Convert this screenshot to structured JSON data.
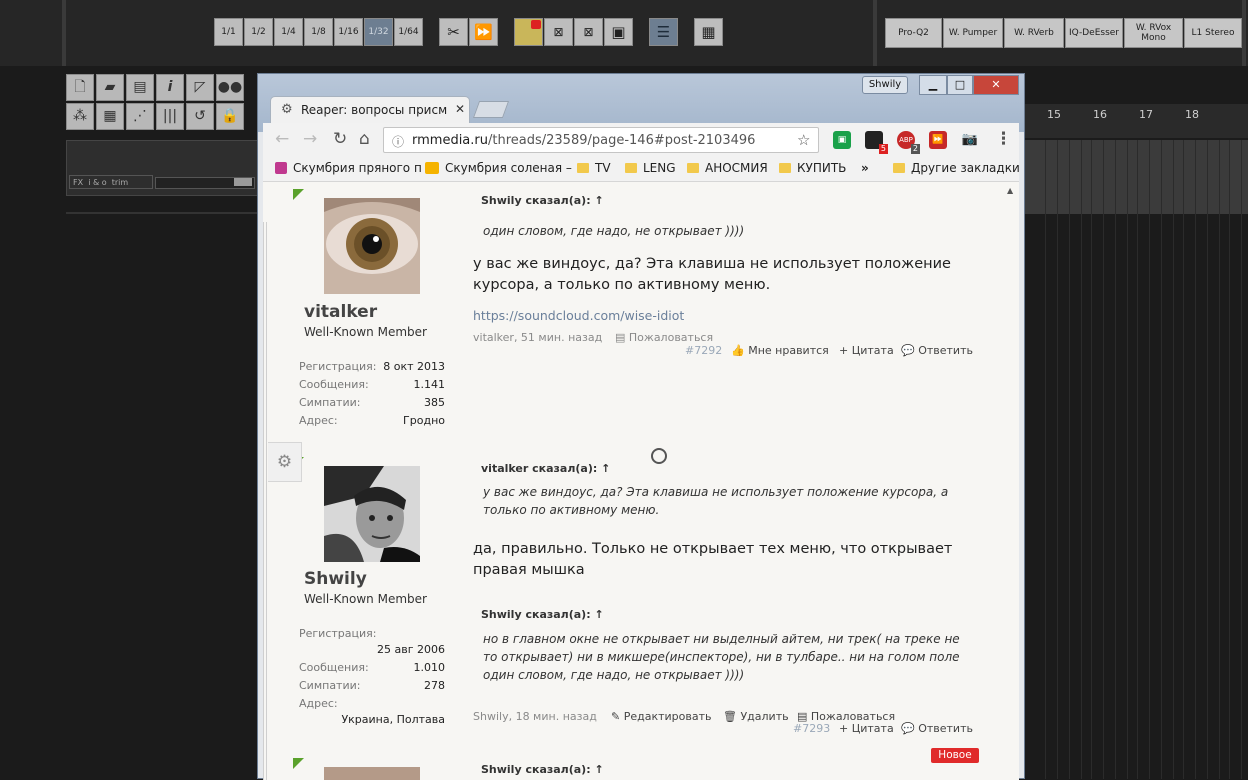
{
  "reaper": {
    "grid_buttons": [
      "1/1",
      "1/2",
      "1/4",
      "1/8",
      "1/16",
      "1/32",
      "1/64"
    ],
    "selected_grid": "1/32",
    "fx_buttons": [
      "Pro-Q2",
      "W. Pumper",
      "W. RVerb",
      "IQ-DeEsser",
      "W. RVox Mono",
      "L1 Stereo"
    ],
    "track_controls": {
      "fx": "FX",
      "io": "i & o",
      "trim": "trim"
    },
    "ruler_numbers": [
      "15",
      "16",
      "17",
      "18"
    ]
  },
  "browser": {
    "profile": "Shwily",
    "window_controls": {
      "minimize": "▁",
      "maximize": "□",
      "close": "✕"
    },
    "tab_title": "Reaper: вопросы присм",
    "url_host": "rmmedia.ru",
    "url_path": "/threads/23589/page-146#post-2103496",
    "bookmarks": [
      "Скумбрия пряного п",
      "Скумбрия соленая –",
      "TV",
      "LENG",
      "АНОСМИЯ",
      "КУПИТЬ",
      "Другие закладки"
    ],
    "bookmark_more": "»",
    "ext_badges": {
      "b1": "5",
      "abp": "2"
    }
  },
  "forum": {
    "post1": {
      "username": "vitalker",
      "title": "Well-Known Member",
      "stats": [
        {
          "k": "Регистрация:",
          "v": "8 окт 2013"
        },
        {
          "k": "Сообщения:",
          "v": "1.141"
        },
        {
          "k": "Симпатии:",
          "v": "385"
        },
        {
          "k": "Адрес:",
          "v": "Гродно"
        }
      ],
      "quote_head": "Shwily сказал(а): ↑",
      "quote_body": "один словом, где надо, не открывает ))))",
      "message": "у вас же виндоус, да? Эта клавиша не использует положение курсора, а только по активному меню.",
      "signature": "https://soundcloud.com/wise-idiot",
      "meta_author": "vitalker, 51 мин. назад",
      "report": "Пожаловаться",
      "number": "#7292",
      "like": "Мне нравится",
      "quote": "+ Цитата",
      "reply": "Ответить"
    },
    "post2": {
      "username": "Shwily",
      "title": "Well-Known Member",
      "stats": [
        {
          "k": "Регистрация:",
          "v": "25 авг 2006"
        },
        {
          "k": "Сообщения:",
          "v": "1.010"
        },
        {
          "k": "Симпатии:",
          "v": "278"
        },
        {
          "k": "Адрес:",
          "v": "Украина, Полтава"
        }
      ],
      "quote1_head": "vitalker сказал(а): ↑",
      "quote1_body": "у вас же виндоус, да? Эта клавиша не использует положение курсора, а только по активному меню.",
      "message": "да, правильно. Только не открывает тех меню, что открывает правая мышка",
      "quote2_head": "Shwily сказал(а): ↑",
      "quote2_body": "но в главном окне не открывает ни выделный айтем, ни трек( на треке не то открывает) ни в микшере(инспекторе), ни в тулбаре.. ни на голом поле один словом, где надо, не открывает ))))",
      "meta_author": "Shwily, 18 мин. назад",
      "edit": "Редактировать",
      "delete": "Удалить",
      "report": "Пожаловаться",
      "number": "#7293",
      "quote": "+ Цитата",
      "reply": "Ответить"
    },
    "post3": {
      "quote_head": "Shwily сказал(а): ↑",
      "badge": "Новое"
    }
  }
}
